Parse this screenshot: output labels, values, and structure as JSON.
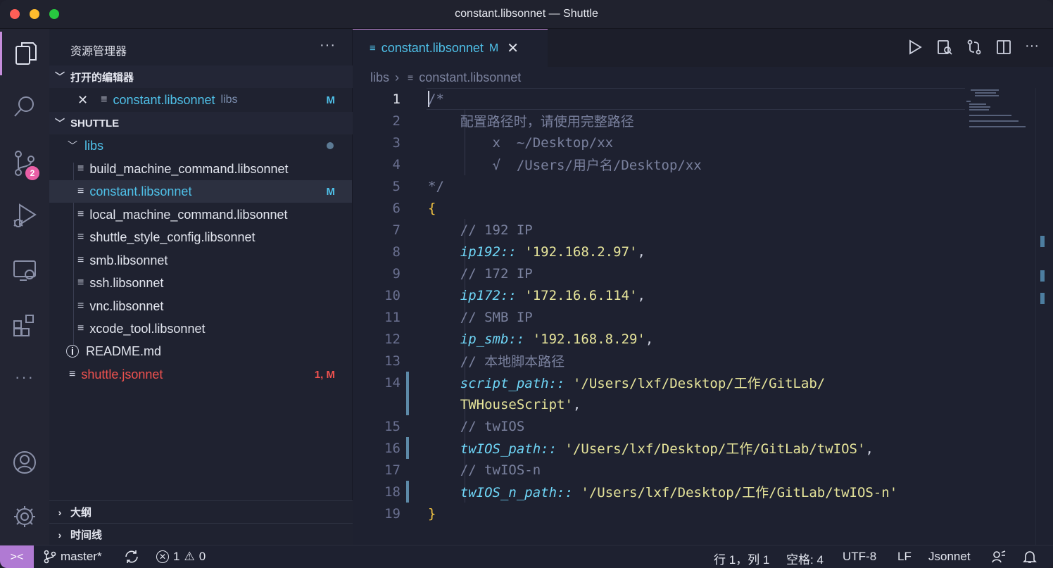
{
  "window": {
    "title": "constant.libsonnet — Shuttle"
  },
  "activity": {
    "items": [
      "explorer-icon",
      "search-icon",
      "source-control-icon",
      "run-debug-icon",
      "remote-explorer-icon",
      "extensions-icon",
      "more-icon",
      "account-icon",
      "settings-icon"
    ],
    "scm_badge": "2"
  },
  "sidebar": {
    "title": "资源管理器",
    "more": "···",
    "open_editors": {
      "label": "打开的编辑器",
      "items": [
        {
          "name": "constant.libsonnet",
          "dir": "libs",
          "status": "M"
        }
      ]
    },
    "project": {
      "label": "SHUTTLE",
      "folder": "libs",
      "files": [
        {
          "name": "build_machine_command.libsonnet"
        },
        {
          "name": "constant.libsonnet",
          "status": "M"
        },
        {
          "name": "local_machine_command.libsonnet"
        },
        {
          "name": "shuttle_style_config.libsonnet"
        },
        {
          "name": "smb.libsonnet"
        },
        {
          "name": "ssh.libsonnet"
        },
        {
          "name": "vnc.libsonnet"
        },
        {
          "name": "xcode_tool.libsonnet"
        }
      ],
      "readme": "README.md",
      "root_file": {
        "name": "shuttle.jsonnet",
        "status": "1, M"
      }
    },
    "outline": "大纲",
    "timeline": "时间线"
  },
  "editor": {
    "tab": {
      "name": "constant.libsonnet",
      "status": "M",
      "close": "✕"
    },
    "breadcrumb": {
      "folder": "libs",
      "file": "constant.libsonnet"
    },
    "lines": [
      {
        "n": "1",
        "tokens": [
          [
            "/*",
            "#7a819e"
          ]
        ]
      },
      {
        "n": "2",
        "tokens": [
          [
            "    配置路径时，请使用完整路径",
            "#7a819e"
          ]
        ]
      },
      {
        "n": "3",
        "tokens": [
          [
            "        x  ~/Desktop/xx",
            "#7a819e"
          ]
        ]
      },
      {
        "n": "4",
        "tokens": [
          [
            "        √  /Users/用户名/Desktop/xx",
            "#7a819e"
          ]
        ]
      },
      {
        "n": "5",
        "tokens": [
          [
            "*/",
            "#7a819e"
          ]
        ]
      },
      {
        "n": "6",
        "tokens": [
          [
            "{",
            "#f4c542"
          ]
        ]
      },
      {
        "n": "7",
        "tokens": [
          [
            "    // 192 IP",
            "#7a819e"
          ]
        ]
      },
      {
        "n": "8",
        "tokens": [
          [
            "    ",
            "#cfd3e1"
          ],
          [
            "ip192::",
            "#6fd6f7",
            "italic"
          ],
          [
            " ",
            "#cfd3e1"
          ],
          [
            "'192.168.2.97'",
            "#e6e49a"
          ],
          [
            ",",
            "#cfd3e1"
          ]
        ]
      },
      {
        "n": "9",
        "tokens": [
          [
            "    // 172 IP",
            "#7a819e"
          ]
        ]
      },
      {
        "n": "10",
        "tokens": [
          [
            "    ",
            "#cfd3e1"
          ],
          [
            "ip172::",
            "#6fd6f7",
            "italic"
          ],
          [
            " ",
            "#cfd3e1"
          ],
          [
            "'172.16.6.114'",
            "#e6e49a"
          ],
          [
            ",",
            "#cfd3e1"
          ]
        ]
      },
      {
        "n": "11",
        "tokens": [
          [
            "    // SMB IP",
            "#7a819e"
          ]
        ]
      },
      {
        "n": "12",
        "tokens": [
          [
            "    ",
            "#cfd3e1"
          ],
          [
            "ip_smb::",
            "#6fd6f7",
            "italic"
          ],
          [
            " ",
            "#cfd3e1"
          ],
          [
            "'192.168.8.29'",
            "#e6e49a"
          ],
          [
            ",",
            "#cfd3e1"
          ]
        ]
      },
      {
        "n": "13",
        "tokens": [
          [
            "    // 本地脚本路径",
            "#7a819e"
          ]
        ]
      },
      {
        "n": "14",
        "tokens": [
          [
            "    ",
            "#cfd3e1"
          ],
          [
            "script_path::",
            "#6fd6f7",
            "italic"
          ],
          [
            " ",
            "#cfd3e1"
          ],
          [
            "'/Users/lxf/Desktop/工作/GitLab/",
            "#e6e49a"
          ]
        ]
      },
      {
        "n": "",
        "tokens": [
          [
            "    ",
            "#cfd3e1"
          ],
          [
            "TWHouseScript'",
            "#e6e49a"
          ],
          [
            ",",
            "#cfd3e1"
          ]
        ]
      },
      {
        "n": "15",
        "tokens": [
          [
            "    // twIOS",
            "#7a819e"
          ]
        ]
      },
      {
        "n": "16",
        "tokens": [
          [
            "    ",
            "#cfd3e1"
          ],
          [
            "twIOS_path::",
            "#6fd6f7",
            "italic"
          ],
          [
            " ",
            "#cfd3e1"
          ],
          [
            "'/Users/lxf/Desktop/工作/GitLab/twIOS'",
            "#e6e49a"
          ],
          [
            ",",
            "#cfd3e1"
          ]
        ]
      },
      {
        "n": "17",
        "tokens": [
          [
            "    // twIOS-n",
            "#7a819e"
          ]
        ]
      },
      {
        "n": "18",
        "tokens": [
          [
            "    ",
            "#cfd3e1"
          ],
          [
            "twIOS_n_path::",
            "#6fd6f7",
            "italic"
          ],
          [
            " ",
            "#cfd3e1"
          ],
          [
            "'/Users/lxf/Desktop/工作/GitLab/twIOS-n'",
            "#e6e49a"
          ]
        ]
      },
      {
        "n": "19",
        "tokens": [
          [
            "}",
            "#f4c542"
          ]
        ]
      }
    ]
  },
  "statusbar": {
    "remote": "remote-icon",
    "branch": "master*",
    "sync": "sync-icon",
    "errors": "1",
    "warnings": "0",
    "position": "行 1，列 1",
    "spaces": "空格: 4",
    "encoding": "UTF-8",
    "eol": "LF",
    "language": "Jsonnet"
  },
  "colors": {
    "accent": "#c58ddb",
    "modified": "#4fc1e9",
    "error_file": "#f0524f",
    "badge": "#e95fa6",
    "property": "#6fd6f7",
    "string": "#e6e49a",
    "comment": "#7a819e",
    "brace": "#f4c542"
  }
}
